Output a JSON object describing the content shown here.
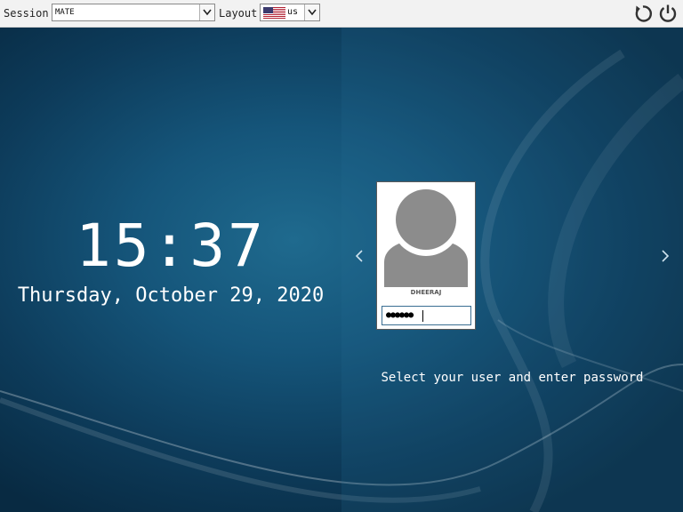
{
  "topbar": {
    "session_label": "Session",
    "session_value": "MATE",
    "layout_label": "Layout",
    "layout_value": "us",
    "layout_flag_icon": "us-flag-icon",
    "reboot_icon": "reboot-icon",
    "power_icon": "power-icon"
  },
  "clock": {
    "time": "15:37",
    "date": "Thursday, October 29, 2020"
  },
  "user_card": {
    "username": "DHEERAJ",
    "password_mask": "●●●●●●",
    "avatar_icon": "user-avatar-icon"
  },
  "nav": {
    "prev_icon": "chevron-left-icon",
    "next_icon": "chevron-right-icon"
  },
  "hint": "Select your user and enter password",
  "colors": {
    "background": "#0d3b5a",
    "text": "#ffffff",
    "topbar": "#f2f2f2"
  }
}
